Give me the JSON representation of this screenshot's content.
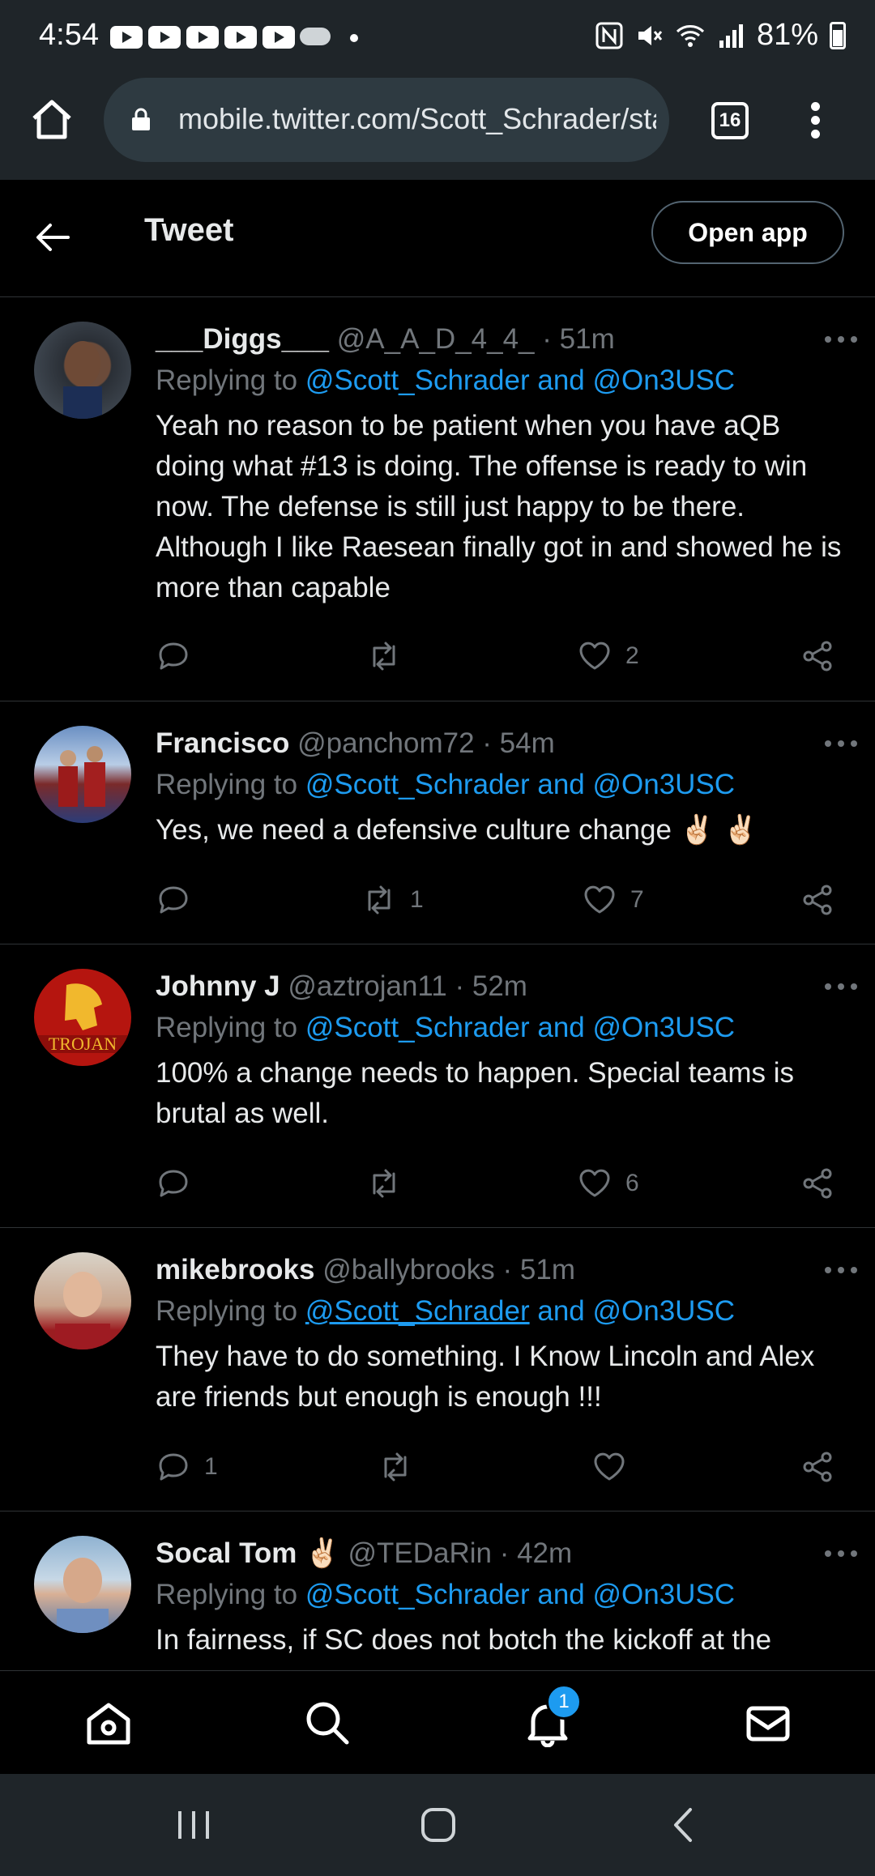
{
  "status_bar": {
    "time": "4:54",
    "battery": "81%"
  },
  "browser": {
    "url": "mobile.twitter.com/Scott_Schrader/sta",
    "tab_count": "16"
  },
  "header": {
    "title": "Tweet",
    "open_app_label": "Open app"
  },
  "tweets": [
    {
      "name": "___Diggs___",
      "emoji": "",
      "handle": "@A_A_D_4_4_",
      "time": "· 51m",
      "replying_prefix": "Replying to",
      "reply_user1": "@Scott_Schrader",
      "reply_and": "and",
      "reply_user2": "@On3USC",
      "text": "Yeah no reason to be patient when you have aQB doing what #13 is doing. The offense is ready to win now. The defense is still just happy to be there. Although I like Raesean finally got in and showed he is more than capable",
      "replies": "",
      "retweets": "",
      "likes": "2"
    },
    {
      "name": "Francisco",
      "emoji": "",
      "handle": "@panchom72",
      "time": "· 54m",
      "replying_prefix": "Replying to",
      "reply_user1": "@Scott_Schrader",
      "reply_and": "and",
      "reply_user2": "@On3USC",
      "text": "Yes, we need a defensive culture change ✌🏻 ✌🏻",
      "replies": "",
      "retweets": "1",
      "likes": "7"
    },
    {
      "name": "Johnny J",
      "emoji": "",
      "handle": "@aztrojan11",
      "time": "· 52m",
      "replying_prefix": "Replying to",
      "reply_user1": "@Scott_Schrader",
      "reply_and": "and",
      "reply_user2": "@On3USC",
      "text": "100% a change needs to happen. Special teams is brutal as well.",
      "replies": "",
      "retweets": "",
      "likes": "6"
    },
    {
      "name": "mikebrooks",
      "emoji": "",
      "handle": "@ballybrooks",
      "time": "· 51m",
      "replying_prefix": "Replying to",
      "reply_user1": "@Scott_Schrader",
      "reply_and": "and",
      "reply_user2": "@On3USC",
      "text": "They have to do something. I Know Lincoln and Alex are friends but enough is enough !!!",
      "replies": "1",
      "retweets": "",
      "likes": ""
    },
    {
      "name": "Socal Tom",
      "emoji": "✌🏻",
      "handle": "@TEDaRin",
      "time": "· 42m",
      "replying_prefix": "Replying to",
      "reply_user1": "@Scott_Schrader",
      "reply_and": "and",
      "reply_user2": "@On3USC",
      "text": "In fairness, if SC does not botch the kickoff at the"
    }
  ],
  "bottom_nav": {
    "notification_count": "1"
  },
  "colors": {
    "background": "#000000",
    "accent": "#1d9bf0",
    "muted": "#71767b",
    "chrome": "#1f2529"
  }
}
